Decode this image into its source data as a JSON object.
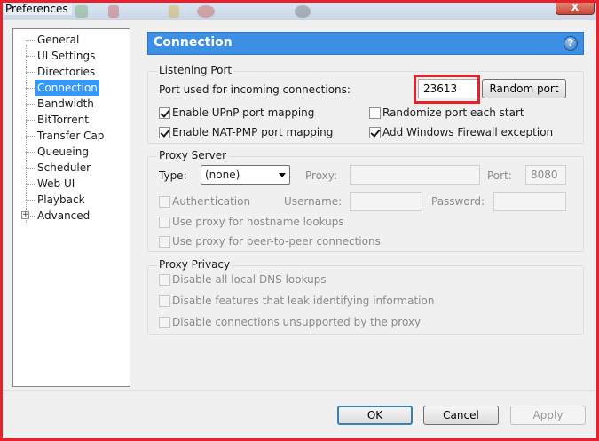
{
  "window": {
    "title": "Preferences",
    "close_label": "X"
  },
  "sidebar": {
    "items": [
      {
        "label": "General"
      },
      {
        "label": "UI Settings"
      },
      {
        "label": "Directories"
      },
      {
        "label": "Connection"
      },
      {
        "label": "Bandwidth"
      },
      {
        "label": "BitTorrent"
      },
      {
        "label": "Transfer Cap"
      },
      {
        "label": "Queueing"
      },
      {
        "label": "Scheduler"
      },
      {
        "label": "Web UI"
      },
      {
        "label": "Playback"
      },
      {
        "label": "Advanced"
      }
    ],
    "selected": "Connection",
    "expander_symbol": "+"
  },
  "header": {
    "title": "Connection",
    "help_symbol": "?"
  },
  "listening_port": {
    "title": "Listening Port",
    "port_label": "Port used for incoming connections:",
    "port_value": "23613",
    "random_port_label": "Random port",
    "upnp_label": "Enable UPnP port mapping",
    "upnp_checked": true,
    "natpmp_label": "Enable NAT-PMP port mapping",
    "natpmp_checked": true,
    "randomize_label": "Randomize port each start",
    "randomize_checked": false,
    "firewall_label": "Add Windows Firewall exception",
    "firewall_checked": true
  },
  "proxy_server": {
    "title": "Proxy Server",
    "type_label": "Type:",
    "type_value": "(none)",
    "proxy_label": "Proxy:",
    "proxy_value": "",
    "port_label": "Port:",
    "port_value": "8080",
    "auth_label": "Authentication",
    "username_label": "Username:",
    "password_label": "Password:",
    "hostname_label": "Use proxy for hostname lookups",
    "p2p_label": "Use proxy for peer-to-peer connections"
  },
  "proxy_privacy": {
    "title": "Proxy Privacy",
    "dns_label": "Disable all local DNS lookups",
    "leak_label": "Disable features that leak identifying information",
    "unsupported_label": "Disable connections unsupported by the proxy"
  },
  "footer": {
    "ok_label": "OK",
    "cancel_label": "Cancel",
    "apply_label": "Apply"
  },
  "colors": {
    "highlight": "#e8202a",
    "header_bg": "#3c8fe3",
    "selection": "#3399ff"
  }
}
